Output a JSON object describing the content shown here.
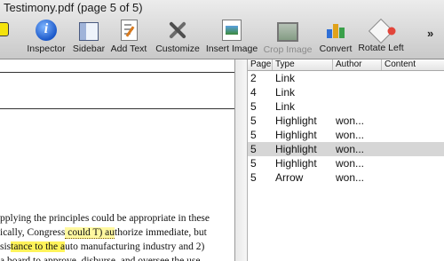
{
  "window": {
    "title": "Testimony.pdf (page 5 of 5)"
  },
  "toolbar": {
    "items": [
      {
        "label": "Inspector",
        "icon": "info-icon"
      },
      {
        "label": "Sidebar",
        "icon": "sidebar-icon"
      },
      {
        "label": "Add Text",
        "icon": "add-text-icon"
      },
      {
        "label": "Customize",
        "icon": "tools-icon"
      },
      {
        "label": "Insert Image",
        "icon": "insert-image-icon"
      },
      {
        "label": "Crop Image",
        "icon": "crop-icon",
        "disabled": true
      },
      {
        "label": "Convert",
        "icon": "convert-icon"
      },
      {
        "label": "Rotate Left",
        "icon": "rotate-left-icon"
      }
    ],
    "overflow": "»"
  },
  "document": {
    "lines": [
      {
        "parts": [
          {
            "text": "pplying the principles could be appropriate in these"
          }
        ]
      },
      {
        "parts": [
          {
            "text": "ically, Congress"
          },
          {
            "text": " could T) au",
            "style": "hl-dot"
          },
          {
            "text": "thorize immediate, but"
          }
        ]
      },
      {
        "parts": [
          {
            "text": "sis"
          },
          {
            "text": "tance to the a",
            "style": "hl"
          },
          {
            "text": "uto manufacturing industry and 2)"
          }
        ]
      },
      {
        "parts": [
          {
            "text": "a board to approve, disburse, and oversee the use",
            "style": "ul"
          }
        ]
      }
    ]
  },
  "annotations": {
    "columns": [
      "Page",
      "Type",
      "Author",
      "Content"
    ],
    "rows": [
      {
        "page": "2",
        "type": "Link",
        "author": "",
        "content": ""
      },
      {
        "page": "4",
        "type": "Link",
        "author": "",
        "content": ""
      },
      {
        "page": "5",
        "type": "Link",
        "author": "",
        "content": ""
      },
      {
        "page": "5",
        "type": "Highlight",
        "author": "won...",
        "content": ""
      },
      {
        "page": "5",
        "type": "Highlight",
        "author": "won...",
        "content": ""
      },
      {
        "page": "5",
        "type": "Highlight",
        "author": "won...",
        "content": "",
        "selected": true
      },
      {
        "page": "5",
        "type": "Highlight",
        "author": "won...",
        "content": ""
      },
      {
        "page": "5",
        "type": "Arrow",
        "author": "won...",
        "content": ""
      }
    ]
  },
  "colors": {
    "highlight": "#fff35a",
    "selected_row": "#d6d6d6",
    "accent": "#1b58c9"
  }
}
